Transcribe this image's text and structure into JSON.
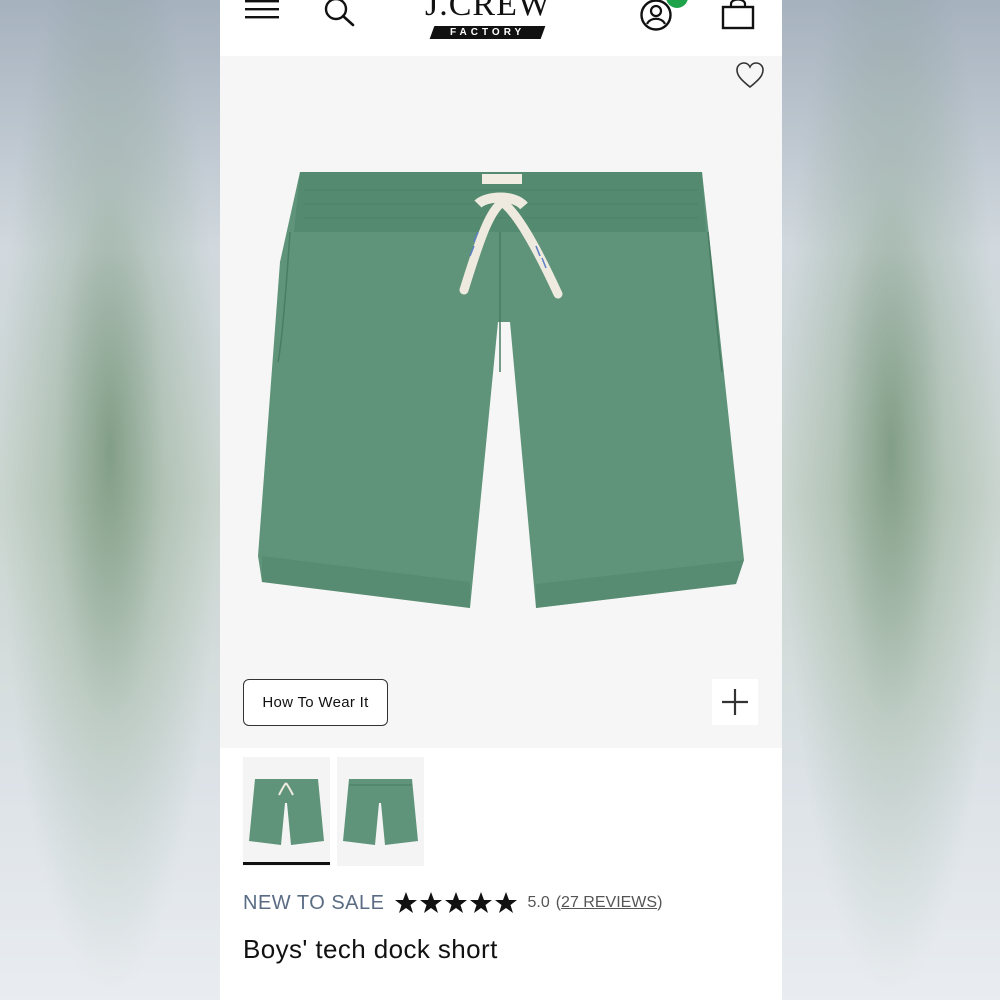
{
  "header": {
    "logo_text": "J.CREW",
    "logo_subtext": "FACTORY",
    "badge_color": "#1fa34a",
    "icons": [
      "menu-icon",
      "search-icon",
      "account-icon",
      "bag-icon"
    ]
  },
  "product": {
    "image_color": "#5f947a",
    "how_to_wear_label": "How To Wear It",
    "zoom_icon": "plus-icon",
    "wishlist_icon": "heart-outline-icon",
    "thumbnails": [
      {
        "name": "front view",
        "selected": true
      },
      {
        "name": "back view",
        "selected": false
      }
    ],
    "sale_label": "NEW TO SALE",
    "rating_stars": 5,
    "rating_value": "5.0",
    "reviews_open": "(",
    "reviews_text": "27 REVIEWS",
    "reviews_close": ")",
    "title": "Boys' tech dock short"
  }
}
